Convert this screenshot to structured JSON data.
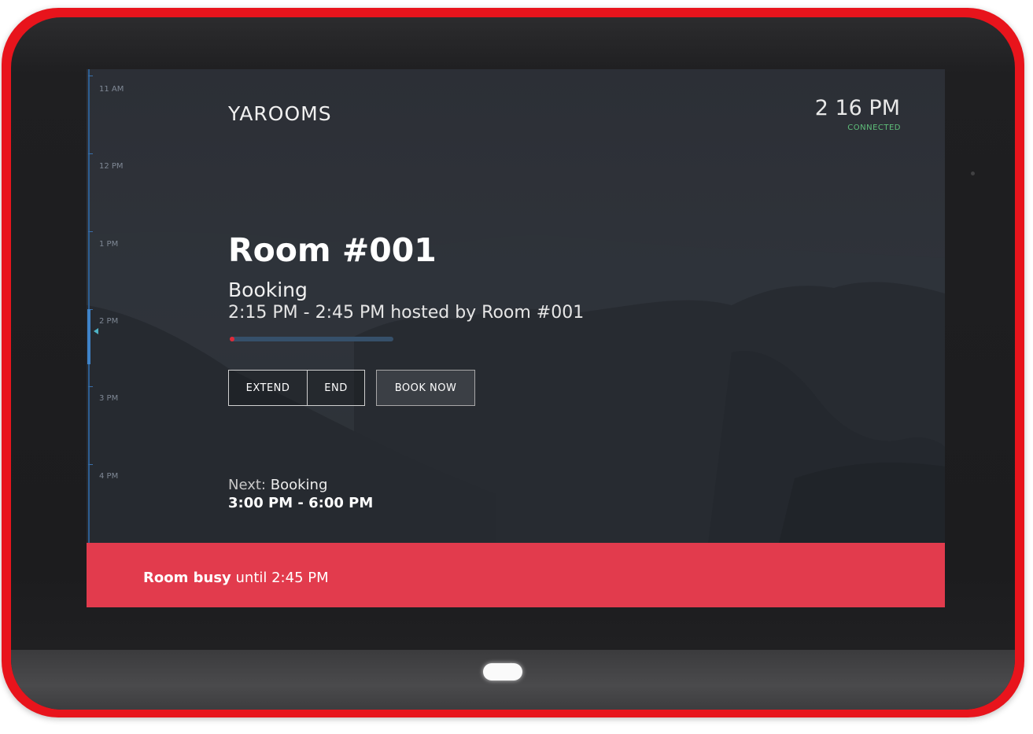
{
  "app": {
    "brand": "YAROOMS",
    "clock": "2 16 PM",
    "connection_status": "CONNECTED"
  },
  "timeline": {
    "hours": [
      "11 AM",
      "12 PM",
      "1 PM",
      "2 PM",
      "3 PM",
      "4 PM"
    ]
  },
  "room": {
    "name": "Room #001"
  },
  "current_booking": {
    "title": "Booking",
    "time_range": "2:15 PM - 2:45 PM hosted by Room #001",
    "progress_percent": 3
  },
  "actions": {
    "extend_label": "EXTEND",
    "end_label": "END",
    "book_now_label": "BOOK NOW"
  },
  "next_booking": {
    "prefix": "Next:",
    "title": "Booking",
    "time_range": "3:00 PM - 6:00 PM"
  },
  "status": {
    "strong": "Room busy",
    "rest": "until 2:45 PM"
  },
  "colors": {
    "device_frame": "#e8141c",
    "status_bar": "#e23b4d",
    "connected": "#5fbf7a",
    "timeline": "#2d5e92",
    "progress_fill": "#e02a38",
    "progress_track": "#36506a"
  }
}
